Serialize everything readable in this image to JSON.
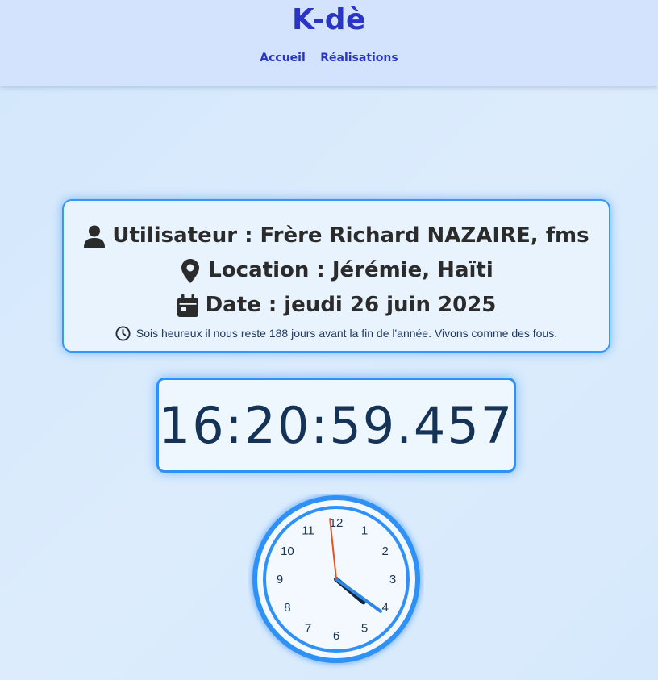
{
  "header": {
    "brand": "K-dè",
    "nav": [
      {
        "label": "Accueil"
      },
      {
        "label": "Réalisations"
      }
    ]
  },
  "info": {
    "user_label": "Utilisateur : Frère Richard NAZAIRE, fms",
    "location_label": "Location : Jérémie, Haïti",
    "date_label": "Date : jeudi 26 juin 2025",
    "note": "Sois heureux il nous reste 188 jours avant la fin de l'année. Vivons comme des fous."
  },
  "digital_clock": {
    "time": "16:20:59.457"
  },
  "analog_clock": {
    "numbers": [
      "12",
      "1",
      "2",
      "3",
      "4",
      "5",
      "6",
      "7",
      "8",
      "9",
      "10",
      "11"
    ],
    "hour": 16,
    "minute": 20,
    "second": 59,
    "colors": {
      "face": "#f4f9ff",
      "rim": "#2f91f5",
      "hour_hand": "#0d2740",
      "minute_hand": "#2d86e4",
      "second_hand": "#e8501e"
    }
  },
  "icons": {
    "user": "user-icon",
    "location": "map-marker-icon",
    "date": "calendar-icon",
    "clock": "clock-icon"
  }
}
